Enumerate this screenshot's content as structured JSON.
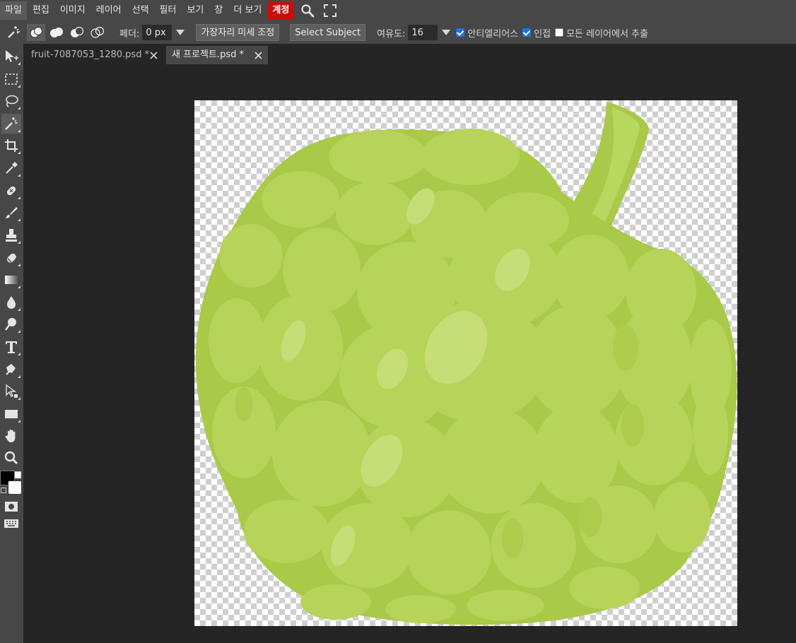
{
  "menu": {
    "items": [
      "파일",
      "편집",
      "이미지",
      "레이어",
      "선택",
      "필터",
      "보기",
      "창",
      "더 보기"
    ],
    "account": "계정"
  },
  "options": {
    "feather_label": "페더:",
    "feather_value": "0 px",
    "refine_edge": "가장자리 미세 조정",
    "select_subject": "Select Subject",
    "tolerance_label": "여유도:",
    "tolerance_value": "16",
    "antialias_label": "안티엘리어스",
    "antialias_checked": true,
    "contiguous_label": "인접",
    "contiguous_checked": true,
    "all_layers_label": "모든 레이어에서 추출",
    "all_layers_checked": false
  },
  "tabs": [
    {
      "label": "fruit-7087053_1280.psd *",
      "active": false
    },
    {
      "label": "새 프로젝트.psd *",
      "active": true
    }
  ],
  "colors": {
    "accent_account": "#c80d0d",
    "checkbox": "#1f72e6",
    "fruit_light": "#b6d35a",
    "fruit_dark": "#9fc13b",
    "fruit_outline": "#a9c948"
  }
}
